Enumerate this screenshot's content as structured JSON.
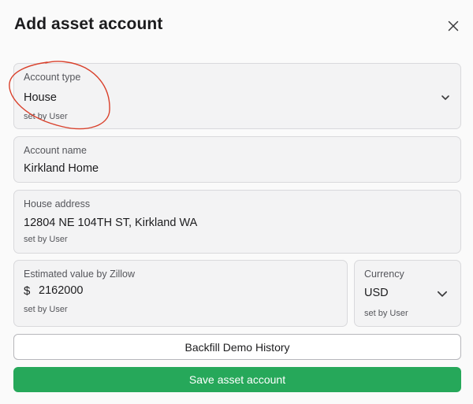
{
  "dialog": {
    "title": "Add asset account",
    "close_icon": "close-icon"
  },
  "fields": {
    "account_type": {
      "label": "Account type",
      "value": "House",
      "note": "set by User",
      "icon": "chevron-down-icon"
    },
    "account_name": {
      "label": "Account name",
      "value": "Kirkland Home"
    },
    "house_address": {
      "label": "House address",
      "value": "12804 NE 104TH ST, Kirkland WA",
      "note": "set by User"
    },
    "estimated_value": {
      "label": "Estimated value by Zillow",
      "currency_symbol": "$",
      "value": "2162000",
      "note": "set by User"
    },
    "currency": {
      "label": "Currency",
      "value": "USD",
      "note": "set by User",
      "icon": "chevron-down-icon"
    }
  },
  "actions": {
    "backfill_label": "Backfill Demo History",
    "save_label": "Save asset account"
  },
  "colors": {
    "save_button": "#26a85a",
    "annotation_stroke": "#d9402b"
  }
}
